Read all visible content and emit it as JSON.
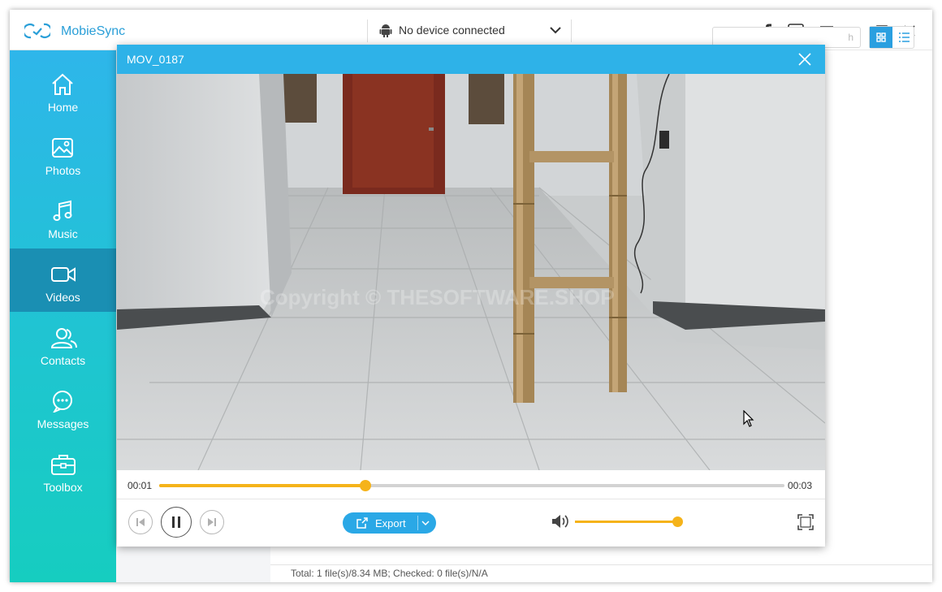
{
  "app": {
    "name": "MobieSync",
    "device_status": "No device connected",
    "brand_color": "#2eb2e8"
  },
  "titlebar_icons": [
    "facebook-icon",
    "feedback-icon",
    "menu-icon",
    "minimize-icon",
    "maximize-icon",
    "close-icon"
  ],
  "sidebar": {
    "items": [
      {
        "label": "Home",
        "icon": "home-icon",
        "active": false
      },
      {
        "label": "Photos",
        "icon": "photo-icon",
        "active": false
      },
      {
        "label": "Music",
        "icon": "music-icon",
        "active": false
      },
      {
        "label": "Videos",
        "icon": "video-icon",
        "active": true
      },
      {
        "label": "Contacts",
        "icon": "contacts-icon",
        "active": false
      },
      {
        "label": "Messages",
        "icon": "messages-icon",
        "active": false
      },
      {
        "label": "Toolbox",
        "icon": "toolbox-icon",
        "active": false
      }
    ]
  },
  "toolbar": {
    "search_placeholder_fragment": "h",
    "view_modes": [
      "grid-view",
      "list-view"
    ],
    "active_view": "grid-view"
  },
  "status": {
    "text": "Total: 1 file(s)/8.34 MB; Checked: 0 file(s)/N/A"
  },
  "player": {
    "title": "MOV_0187",
    "current_time": "00:01",
    "total_time": "00:03",
    "progress_fraction": 0.33,
    "volume_fraction": 1.0,
    "export_label": "Export",
    "state": "playing",
    "watermark": "Copyright © THESOFTWARE.SHOP"
  }
}
